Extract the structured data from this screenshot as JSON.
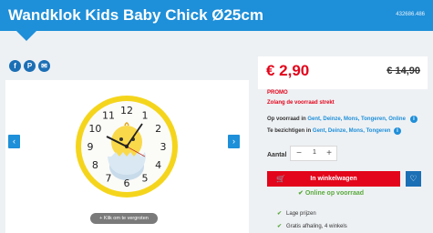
{
  "header": {
    "title": "Wandklok Kids Baby Chick Ø25cm",
    "sku": "432686.486"
  },
  "share": {
    "facebook": "f",
    "pinterest": "P",
    "email": "✉"
  },
  "gallery": {
    "zoom_label": "+ Klik om te vergroten",
    "prev": "‹",
    "next": "›",
    "clock_numbers": [
      "12",
      "1",
      "2",
      "3",
      "4",
      "5",
      "6",
      "7",
      "8",
      "9",
      "10",
      "11"
    ]
  },
  "pricing": {
    "price": "€ 2,90",
    "old_price": "€ 14,90",
    "promo_label": "PROMO",
    "promo_note": "Zolang de voorraad strekt"
  },
  "stock": {
    "op_voorraad_prefix": "Op voorraad in",
    "op_voorraad_stores": "Gent, Deinze, Mons, Tongeren, Online",
    "te_bezichtigen_prefix": "Te bezichtigen in",
    "te_bezichtigen_stores": "Gent, Deinze, Mons, Tongeren"
  },
  "quantity": {
    "label": "Aantal",
    "value": "1",
    "minus": "−",
    "plus": "+"
  },
  "cart": {
    "button_label": "In winkelwagen",
    "online_stock": "Online op voorraad"
  },
  "usps": [
    "Lage prijzen",
    "Gratis afhaling, 4 winkels"
  ],
  "colors": {
    "brand_blue": "#1e8fd9",
    "promo_red": "#e3051b",
    "success_green": "#5aaa3c"
  }
}
